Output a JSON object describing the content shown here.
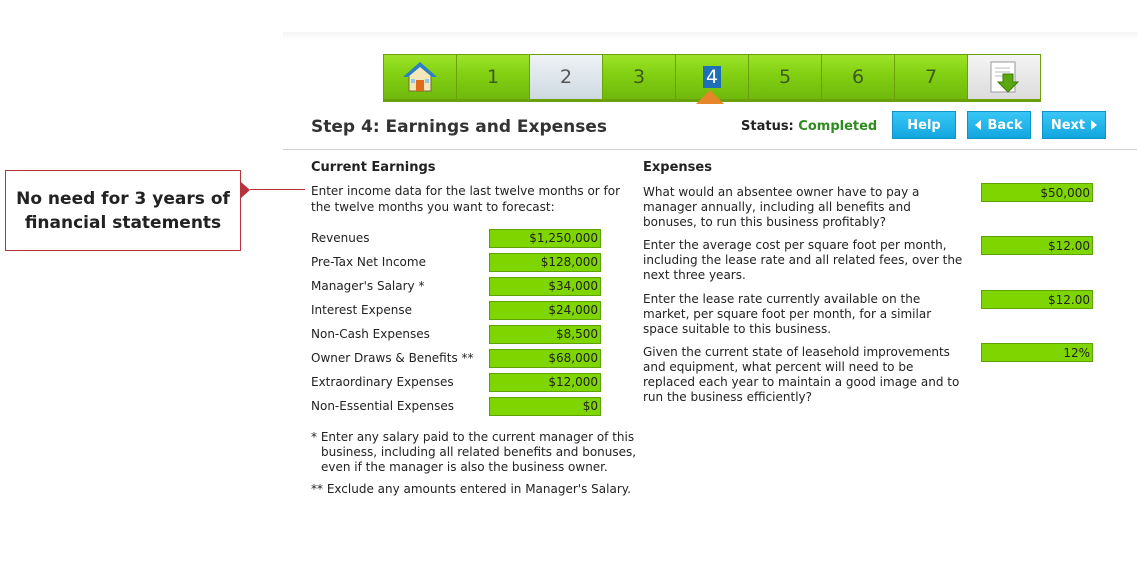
{
  "callout": {
    "line1": "No need for 3 years of",
    "line2": "financial statements"
  },
  "steps": [
    {
      "label": "",
      "icon": "home-icon"
    },
    {
      "label": "1"
    },
    {
      "label": "2"
    },
    {
      "label": "3"
    },
    {
      "label": "4"
    },
    {
      "label": "5"
    },
    {
      "label": "6"
    },
    {
      "label": "7"
    },
    {
      "label": "",
      "icon": "download-document-icon"
    }
  ],
  "header": {
    "title": "Step 4: Earnings and Expenses",
    "status_label": "Status:",
    "status_value": "Completed",
    "help_label": "Help",
    "back_label": "Back",
    "next_label": "Next"
  },
  "earnings": {
    "title": "Current Earnings",
    "intro": "Enter income data for the last twelve months or for the twelve months you want to forecast:",
    "rows": [
      {
        "label": "Revenues",
        "value": "$1,250,000"
      },
      {
        "label": "Pre-Tax Net Income",
        "value": "$128,000"
      },
      {
        "label": "Manager's Salary *",
        "value": "$34,000"
      },
      {
        "label": "Interest Expense",
        "value": "$24,000"
      },
      {
        "label": "Non-Cash Expenses",
        "value": "$8,500"
      },
      {
        "label": "Owner Draws & Benefits **",
        "value": "$68,000"
      },
      {
        "label": "Extraordinary Expenses",
        "value": "$12,000"
      },
      {
        "label": "Non-Essential Expenses",
        "value": "$0"
      }
    ],
    "note1_a": "* Enter any salary paid to the current manager of this",
    "note1_b": "business, including all related benefits and bonuses,",
    "note1_c": "even if the manager is also the business owner.",
    "note2": "** Exclude any amounts entered in Manager's Salary."
  },
  "expenses": {
    "title": "Expenses",
    "items": [
      {
        "question": "What would an absentee owner have to pay a manager annually, including all benefits and bonuses, to run this business profitably?",
        "value": "$50,000"
      },
      {
        "question": "Enter the average cost per square foot per month, including the lease rate and all related fees, over the next three years.",
        "value": "$12.00"
      },
      {
        "question": "Enter the lease rate currently available on the market, per square foot per month, for a similar space suitable to this business.",
        "value": "$12.00"
      },
      {
        "question": "Given the current state of leasehold improvements and equipment, what percent will need to be replaced each year to maintain a good image and to run the business efficiently?",
        "value": "12%"
      }
    ]
  },
  "colors": {
    "field_green": "#7fd500",
    "button_blue": "#12a6e0",
    "accent_orange": "#e6862a",
    "callout_red": "#b8323a"
  }
}
